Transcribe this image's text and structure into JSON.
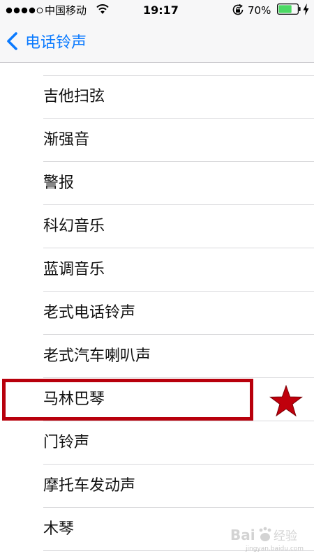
{
  "status_bar": {
    "carrier": "中国移动",
    "time": "19:17",
    "battery_percent": "70%",
    "battery_level": 0.7
  },
  "nav": {
    "back_label": "电话铃声"
  },
  "ringtones": [
    {
      "label": "吉他扫弦"
    },
    {
      "label": "渐强音"
    },
    {
      "label": "警报"
    },
    {
      "label": "科幻音乐"
    },
    {
      "label": "蓝调音乐"
    },
    {
      "label": "老式电话铃声"
    },
    {
      "label": "老式汽车喇叭声"
    },
    {
      "label": "马林巴琴"
    },
    {
      "label": "门铃声"
    },
    {
      "label": "摩托车发动声"
    },
    {
      "label": "木琴"
    }
  ],
  "annotation": {
    "highlight_color": "#b8000c",
    "star_color": "#c0000c",
    "highlighted_item": "马林巴琴"
  },
  "watermark": {
    "logo_text": "Bai度经验",
    "url": "jingyan.baidu.com"
  },
  "colors": {
    "accent": "#0a7aff",
    "battery_fill": "#4cd964"
  }
}
